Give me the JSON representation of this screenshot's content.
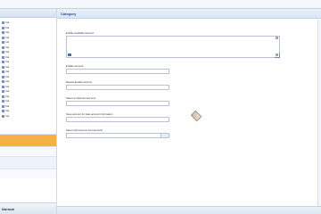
{
  "header": {
    "section_title": "Category"
  },
  "tree": {
    "items": [
      "Cat",
      "Cat",
      "Cat",
      "Cat",
      "Cat",
      "Cat",
      "Cat",
      "Cat",
      "Cat",
      "Cat",
      "Cat",
      "Cat",
      "Cat",
      "Cat",
      "Cat",
      "Cat",
      "Cat",
      "Cat",
      "Cat",
      "Cat"
    ]
  },
  "nav": {
    "items": [
      {
        "label": ""
      },
      {
        "label": ""
      },
      {
        "label": ""
      },
      {
        "label": ""
      }
    ]
  },
  "brand": {
    "text": "Normal"
  },
  "form": {
    "textarea_label": "Enable available account",
    "fields": [
      {
        "label": "Enable account",
        "placeholder": ""
      },
      {
        "label": "Repeat Enable account",
        "placeholder": ""
      },
      {
        "label": "Select an Element account",
        "placeholder": ""
      },
      {
        "label": "Save account for date account information",
        "placeholder": ""
      },
      {
        "label": "Select with account (not account)",
        "placeholder": ""
      }
    ]
  }
}
